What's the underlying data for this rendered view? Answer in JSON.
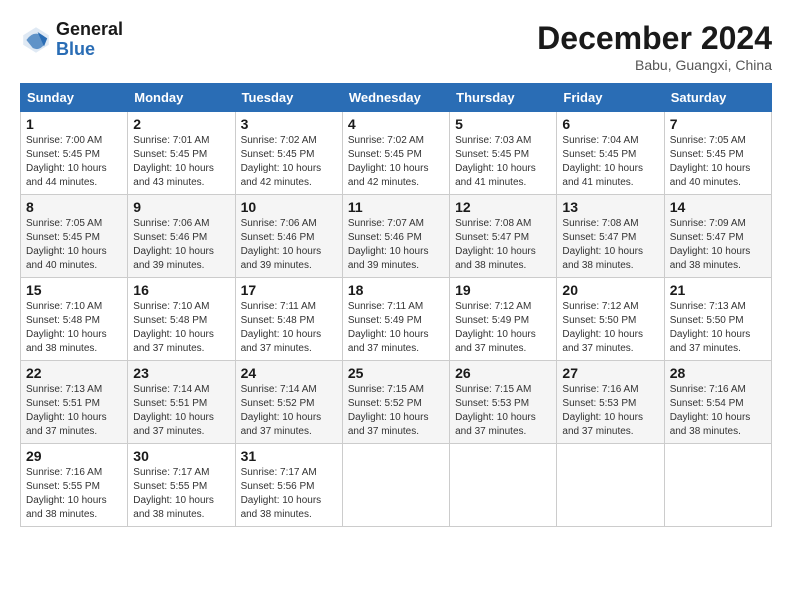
{
  "app": {
    "logo_general": "General",
    "logo_blue": "Blue",
    "month_title": "December 2024",
    "location": "Babu, Guangxi, China"
  },
  "calendar": {
    "headers": [
      "Sunday",
      "Monday",
      "Tuesday",
      "Wednesday",
      "Thursday",
      "Friday",
      "Saturday"
    ],
    "weeks": [
      [
        {
          "day": "",
          "info": ""
        },
        {
          "day": "2",
          "info": "Sunrise: 7:01 AM\nSunset: 5:45 PM\nDaylight: 10 hours\nand 43 minutes."
        },
        {
          "day": "3",
          "info": "Sunrise: 7:02 AM\nSunset: 5:45 PM\nDaylight: 10 hours\nand 42 minutes."
        },
        {
          "day": "4",
          "info": "Sunrise: 7:02 AM\nSunset: 5:45 PM\nDaylight: 10 hours\nand 42 minutes."
        },
        {
          "day": "5",
          "info": "Sunrise: 7:03 AM\nSunset: 5:45 PM\nDaylight: 10 hours\nand 41 minutes."
        },
        {
          "day": "6",
          "info": "Sunrise: 7:04 AM\nSunset: 5:45 PM\nDaylight: 10 hours\nand 41 minutes."
        },
        {
          "day": "7",
          "info": "Sunrise: 7:05 AM\nSunset: 5:45 PM\nDaylight: 10 hours\nand 40 minutes."
        }
      ],
      [
        {
          "day": "1",
          "info": "Sunrise: 7:00 AM\nSunset: 5:45 PM\nDaylight: 10 hours\nand 44 minutes."
        },
        {
          "day": "8",
          "info": "Sunrise: 7:05 AM\nSunset: 5:45 PM\nDaylight: 10 hours\nand 40 minutes."
        },
        {
          "day": "9",
          "info": "Sunrise: 7:06 AM\nSunset: 5:46 PM\nDaylight: 10 hours\nand 39 minutes."
        },
        {
          "day": "10",
          "info": "Sunrise: 7:06 AM\nSunset: 5:46 PM\nDaylight: 10 hours\nand 39 minutes."
        },
        {
          "day": "11",
          "info": "Sunrise: 7:07 AM\nSunset: 5:46 PM\nDaylight: 10 hours\nand 39 minutes."
        },
        {
          "day": "12",
          "info": "Sunrise: 7:08 AM\nSunset: 5:47 PM\nDaylight: 10 hours\nand 38 minutes."
        },
        {
          "day": "13",
          "info": "Sunrise: 7:08 AM\nSunset: 5:47 PM\nDaylight: 10 hours\nand 38 minutes."
        },
        {
          "day": "14",
          "info": "Sunrise: 7:09 AM\nSunset: 5:47 PM\nDaylight: 10 hours\nand 38 minutes."
        }
      ],
      [
        {
          "day": "15",
          "info": "Sunrise: 7:10 AM\nSunset: 5:48 PM\nDaylight: 10 hours\nand 38 minutes."
        },
        {
          "day": "16",
          "info": "Sunrise: 7:10 AM\nSunset: 5:48 PM\nDaylight: 10 hours\nand 37 minutes."
        },
        {
          "day": "17",
          "info": "Sunrise: 7:11 AM\nSunset: 5:48 PM\nDaylight: 10 hours\nand 37 minutes."
        },
        {
          "day": "18",
          "info": "Sunrise: 7:11 AM\nSunset: 5:49 PM\nDaylight: 10 hours\nand 37 minutes."
        },
        {
          "day": "19",
          "info": "Sunrise: 7:12 AM\nSunset: 5:49 PM\nDaylight: 10 hours\nand 37 minutes."
        },
        {
          "day": "20",
          "info": "Sunrise: 7:12 AM\nSunset: 5:50 PM\nDaylight: 10 hours\nand 37 minutes."
        },
        {
          "day": "21",
          "info": "Sunrise: 7:13 AM\nSunset: 5:50 PM\nDaylight: 10 hours\nand 37 minutes."
        }
      ],
      [
        {
          "day": "22",
          "info": "Sunrise: 7:13 AM\nSunset: 5:51 PM\nDaylight: 10 hours\nand 37 minutes."
        },
        {
          "day": "23",
          "info": "Sunrise: 7:14 AM\nSunset: 5:51 PM\nDaylight: 10 hours\nand 37 minutes."
        },
        {
          "day": "24",
          "info": "Sunrise: 7:14 AM\nSunset: 5:52 PM\nDaylight: 10 hours\nand 37 minutes."
        },
        {
          "day": "25",
          "info": "Sunrise: 7:15 AM\nSunset: 5:52 PM\nDaylight: 10 hours\nand 37 minutes."
        },
        {
          "day": "26",
          "info": "Sunrise: 7:15 AM\nSunset: 5:53 PM\nDaylight: 10 hours\nand 37 minutes."
        },
        {
          "day": "27",
          "info": "Sunrise: 7:16 AM\nSunset: 5:53 PM\nDaylight: 10 hours\nand 37 minutes."
        },
        {
          "day": "28",
          "info": "Sunrise: 7:16 AM\nSunset: 5:54 PM\nDaylight: 10 hours\nand 38 minutes."
        }
      ],
      [
        {
          "day": "29",
          "info": "Sunrise: 7:16 AM\nSunset: 5:55 PM\nDaylight: 10 hours\nand 38 minutes."
        },
        {
          "day": "30",
          "info": "Sunrise: 7:17 AM\nSunset: 5:55 PM\nDaylight: 10 hours\nand 38 minutes."
        },
        {
          "day": "31",
          "info": "Sunrise: 7:17 AM\nSunset: 5:56 PM\nDaylight: 10 hours\nand 38 minutes."
        },
        {
          "day": "",
          "info": ""
        },
        {
          "day": "",
          "info": ""
        },
        {
          "day": "",
          "info": ""
        },
        {
          "day": "",
          "info": ""
        }
      ]
    ]
  }
}
